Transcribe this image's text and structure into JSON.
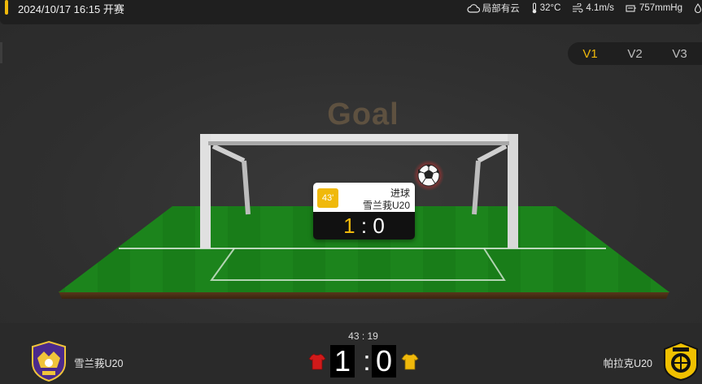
{
  "header": {
    "datetime_status": "2024/10/17 16:15 开赛",
    "weather": {
      "condition": "局部有云",
      "temperature": "32°C",
      "wind": "4.1m/s",
      "pressure": "757mmHg"
    }
  },
  "view_switch": {
    "options": [
      "V1",
      "V2",
      "V3"
    ],
    "active": "V1"
  },
  "stage": {
    "event_title": "Goal"
  },
  "event_popup": {
    "minute": "43'",
    "event_type": "进球",
    "team": "雪兰莪U20",
    "score_home": "1",
    "score_sep": ":",
    "score_away": "0"
  },
  "scoreboard": {
    "clock": "43 : 19",
    "home_team": "雪兰莪U20",
    "away_team": "帕拉克U20",
    "home_score": "1",
    "away_score": "0",
    "separator": ":",
    "home_kit_color": "#d11a1a",
    "away_kit_color": "#f0b90b"
  },
  "colors": {
    "accent": "#f0b90b",
    "pitch": "#1f8a1f",
    "background": "#2a2a2a"
  }
}
